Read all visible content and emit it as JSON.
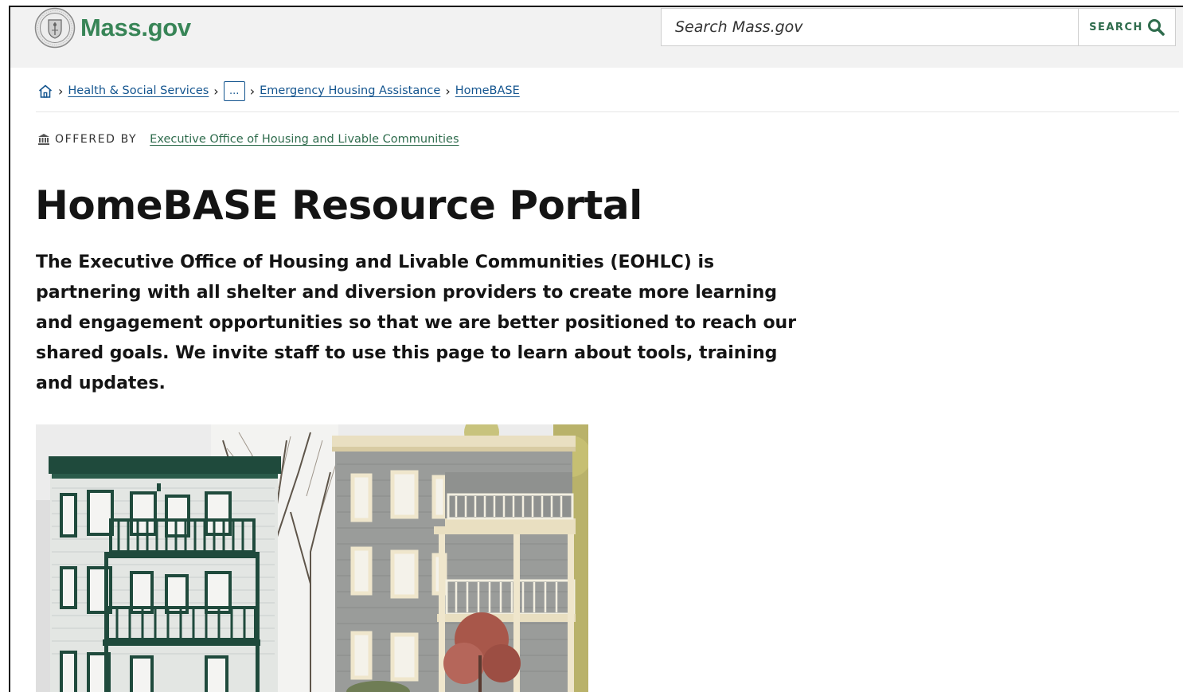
{
  "header": {
    "logo_text": "Mass.gov",
    "search": {
      "placeholder": "Search Mass.gov",
      "button_label": "SEARCH"
    }
  },
  "breadcrumbs": {
    "items": [
      {
        "label": "Health & Social Services"
      },
      {
        "label": "..."
      },
      {
        "label": "Emergency Housing Assistance"
      },
      {
        "label": "HomeBASE"
      }
    ]
  },
  "offered_by": {
    "label": "OFFERED BY",
    "org": "Executive Office of Housing and Livable Communities"
  },
  "page": {
    "title": "HomeBASE Resource Portal",
    "intro": "The Executive Office of Housing and Livable Communities (EOHLC) is partnering with all shelter and diversion providers to create more learning and engagement opportunities so that we are better positioned to reach our shared goals. We invite staff to use this page to learn about tools, training and updates."
  },
  "colors": {
    "brand_green": "#388557",
    "link_blue": "#14558f",
    "header_bg": "#f2f2f2"
  },
  "icons": {
    "home": "home-icon",
    "search": "search-icon",
    "building": "building-icon",
    "seal": "state-seal-icon"
  }
}
